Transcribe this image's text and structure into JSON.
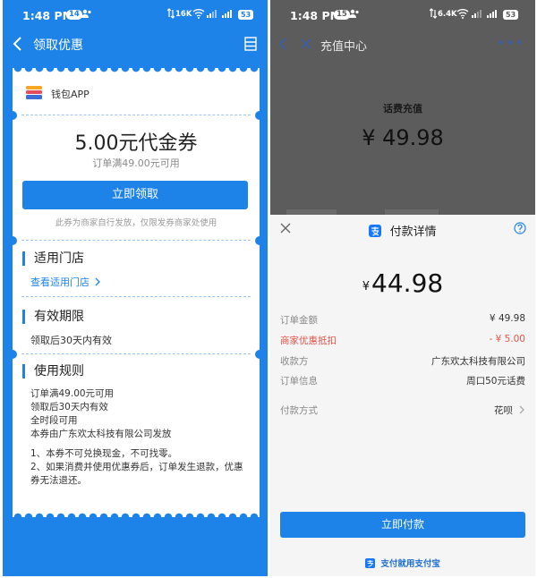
{
  "left": {
    "status": {
      "time": "1:48 PM",
      "badge": "14",
      "speed": "16K",
      "battery": "53"
    },
    "nav": {
      "title": "领取优惠"
    },
    "card": {
      "merchant": "钱包APP",
      "voucher_title": "5.00元代金券",
      "voucher_condition": "订单满49.00元可用",
      "claim_button": "立即领取",
      "claim_note": "此券为商家自行发放，仅限发券商家处使用",
      "stores": {
        "title": "适用门店",
        "link": "查看适用门店"
      },
      "validity": {
        "title": "有效期限",
        "text": "领取后30天内有效"
      },
      "rules": {
        "title": "使用规则",
        "lines": [
          "订单满49.00元可用",
          "领取后30天内有效",
          "全时段可用",
          "本券由广东欢太科技有限公司发放"
        ],
        "notes": [
          "1、本券不可兑换现金，不可找零。",
          "2、如果消费并使用优惠券后，订单发生退款，优惠券无法退还。"
        ]
      }
    }
  },
  "right": {
    "status": {
      "time": "1:48 PM",
      "badge": "15",
      "speed": "6.4K",
      "battery": "53"
    },
    "nav": {
      "title": "充值中心",
      "more": "•••"
    },
    "topup": {
      "label": "话费充值",
      "amount": "¥ 49.98"
    },
    "sheet": {
      "title": "付款详情",
      "amount_symbol": "¥",
      "amount": "44.98",
      "rows": [
        {
          "key": "订单金额",
          "value": "¥ 49.98"
        },
        {
          "key": "商家优惠抵扣",
          "value": "- ¥ 5.00"
        },
        {
          "key": "收款方",
          "value": "广东欢太科技有限公司"
        },
        {
          "key": "订单信息",
          "value": "周口50元话费"
        },
        {
          "key": "付款方式",
          "value": "花呗"
        }
      ],
      "pay_button": "立即付款",
      "footer": "支付就用支付宝"
    }
  },
  "colors": {
    "primary": "#1e83e9",
    "discount": "#e0554a"
  }
}
